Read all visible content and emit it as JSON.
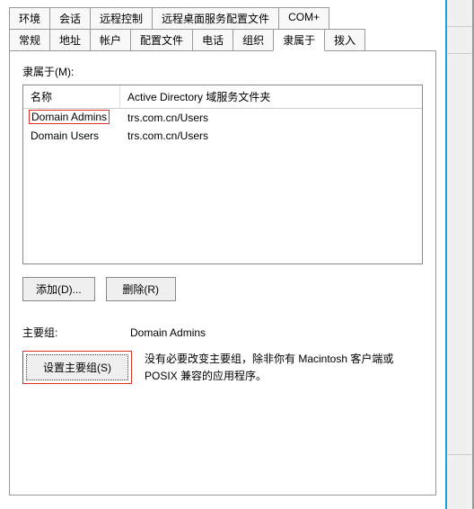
{
  "tabs": {
    "row1": [
      "环境",
      "会话",
      "远程控制",
      "远程桌面服务配置文件",
      "COM+"
    ],
    "row2": [
      "常规",
      "地址",
      "帐户",
      "配置文件",
      "电话",
      "组织",
      "隶属于",
      "拨入"
    ],
    "active": "隶属于"
  },
  "memberOf": {
    "label": "隶属于(M):",
    "columns": {
      "name": "名称",
      "folder": "Active Directory 域服务文件夹"
    },
    "rows": [
      {
        "name": "Domain Admins",
        "folder": "trs.com.cn/Users",
        "highlight": true
      },
      {
        "name": "Domain Users",
        "folder": "trs.com.cn/Users",
        "highlight": false
      }
    ]
  },
  "buttons": {
    "add": "添加(D)...",
    "remove": "删除(R)"
  },
  "primaryGroup": {
    "label": "主要组:",
    "value": "Domain Admins",
    "setButton": "设置主要组(S)",
    "hint": "没有必要改变主要组，除非你有 Macintosh 客户端或 POSIX 兼容的应用程序。"
  }
}
